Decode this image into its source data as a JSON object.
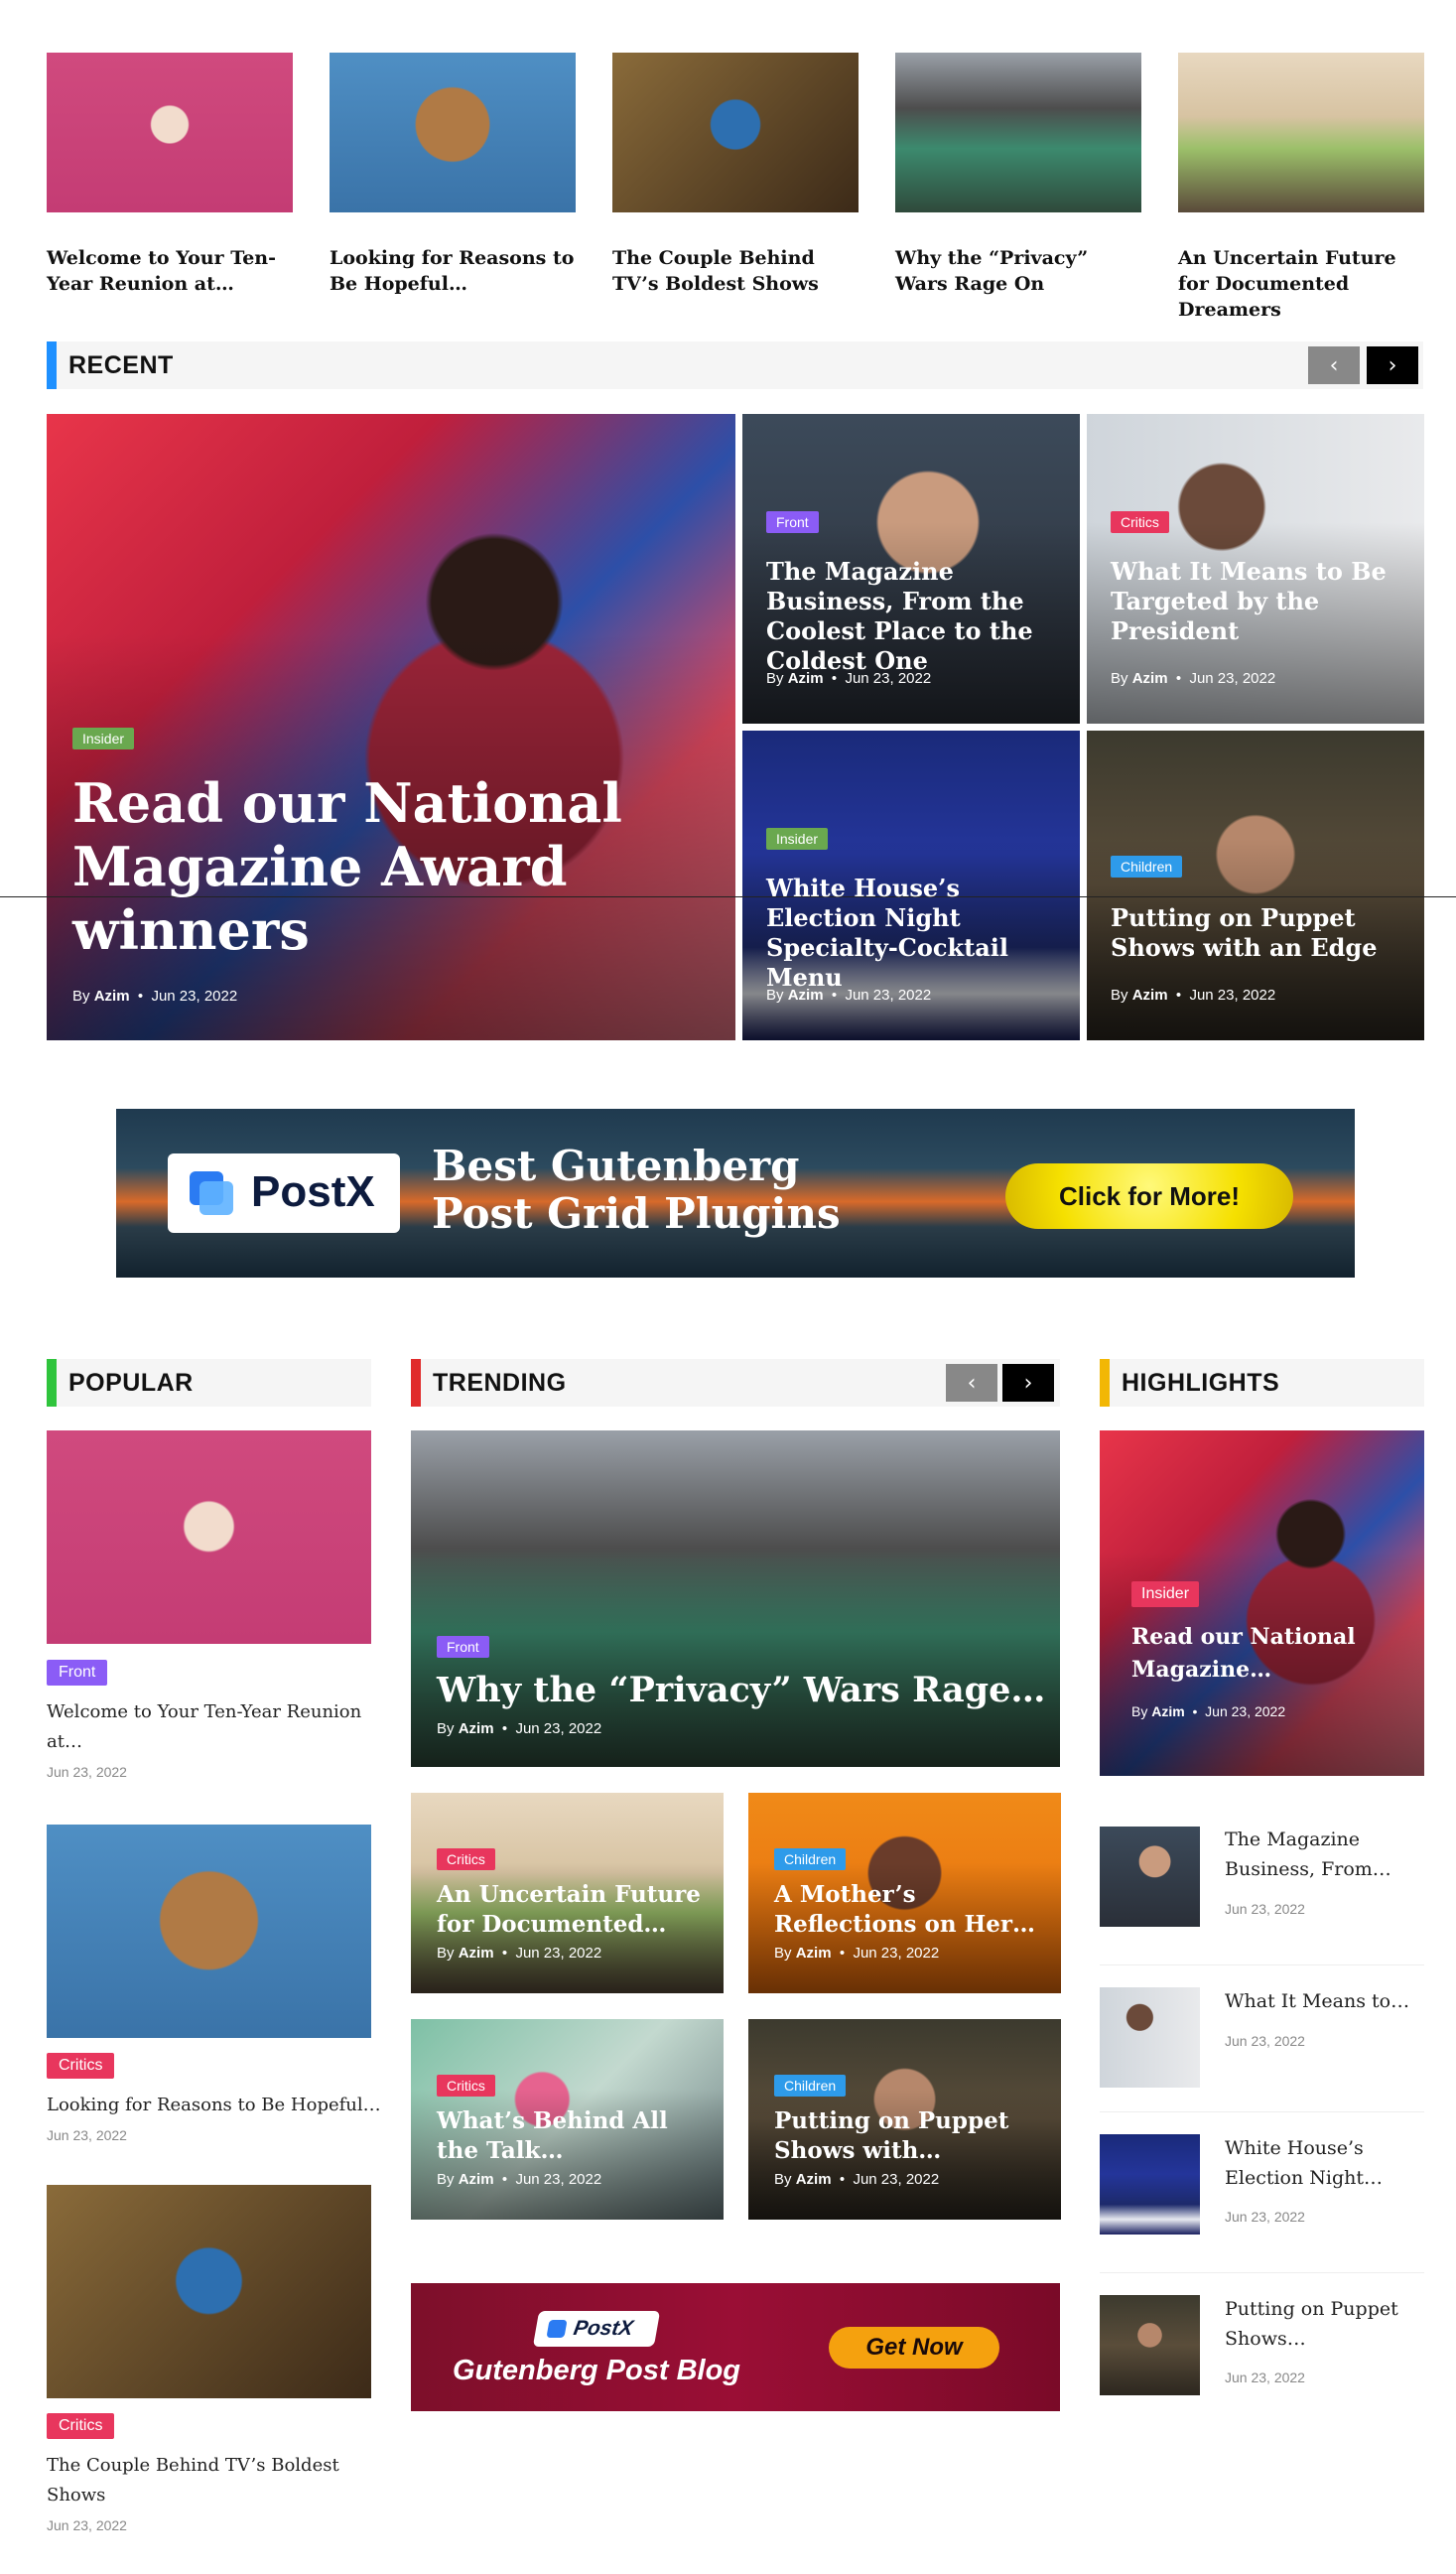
{
  "top_posts": [
    {
      "title": "Welcome to Your Ten-Year Reunion at…"
    },
    {
      "title": "Looking for Reasons to Be Hopeful…"
    },
    {
      "title": "The Couple Behind TV’s Boldest Shows"
    },
    {
      "title": "Why the “Privacy” Wars Rage On"
    },
    {
      "title": "An Uncertain Future for Documented Dreamers"
    }
  ],
  "recent": {
    "heading": "RECENT",
    "accent": "#1e90ff",
    "prev_icon": "‹",
    "next_icon": "›",
    "main": {
      "badge": "Insider",
      "title": "Read our National Magazine Award winners",
      "by": "By",
      "author": "Azim",
      "date": "Jun 23, 2022"
    },
    "grid": [
      {
        "badge": "Front",
        "title": "The Magazine Business, From the Coolest Place to the Coldest One",
        "by": "By",
        "author": "Azim",
        "date": "Jun 23, 2022"
      },
      {
        "badge": "Critics",
        "title": "What It Means to Be Targeted by the President",
        "by": "By",
        "author": "Azim",
        "date": "Jun 23, 2022"
      },
      {
        "badge": "Insider",
        "title": "White House’s Election Night Specialty-Cocktail Menu",
        "by": "By",
        "author": "Azim",
        "date": "Jun 23, 2022"
      },
      {
        "badge": "Children",
        "title": "Putting on Puppet Shows with an Edge",
        "by": "By",
        "author": "Azim",
        "date": "Jun 23, 2022"
      }
    ]
  },
  "banner1": {
    "logo": "PostX",
    "line1": "Best Gutenberg",
    "line2": "Post Grid Plugins",
    "cta": "Click for More!"
  },
  "popular": {
    "heading": "POPULAR",
    "accent": "#2fc43c",
    "items": [
      {
        "badge": "Front",
        "title": "Welcome to Your Ten-Year Reunion at…",
        "date": "Jun 23, 2022"
      },
      {
        "badge": "Critics",
        "title": "Looking for Reasons to Be Hopeful…",
        "date": "Jun 23, 2022"
      },
      {
        "badge": "Critics",
        "title": "The Couple Behind TV’s Boldest Shows",
        "date": "Jun 23, 2022"
      }
    ]
  },
  "trending": {
    "heading": "TRENDING",
    "accent": "#e02b2b",
    "prev_icon": "‹",
    "next_icon": "›",
    "main": {
      "badge": "Front",
      "title": "Why the “Privacy” Wars Rage…",
      "by": "By",
      "author": "Azim",
      "date": "Jun 23, 2022"
    },
    "grid": [
      {
        "badge": "Critics",
        "title": "An Uncertain Future for Documented…",
        "by": "By",
        "author": "Azim",
        "date": "Jun 23, 2022"
      },
      {
        "badge": "Children",
        "title": "A Mother’s Reflections on Her…",
        "by": "By",
        "author": "Azim",
        "date": "Jun 23, 2022"
      },
      {
        "badge": "Critics",
        "title": "What’s Behind All the Talk…",
        "by": "By",
        "author": "Azim",
        "date": "Jun 23, 2022"
      },
      {
        "badge": "Children",
        "title": "Putting on Puppet Shows with…",
        "by": "By",
        "author": "Azim",
        "date": "Jun 23, 2022"
      }
    ]
  },
  "banner2": {
    "logo": "PostX",
    "text": "Gutenberg Post Blog",
    "cta": "Get Now"
  },
  "highlights": {
    "heading": "HIGHLIGHTS",
    "accent": "#f2b705",
    "main": {
      "badge": "Insider",
      "title": "Read our National Magazine…",
      "by": "By",
      "author": "Azim",
      "date": "Jun 23, 2022"
    },
    "items": [
      {
        "title": "The Magazine Business, From…",
        "date": "Jun 23, 2022"
      },
      {
        "title": "What It Means to…",
        "date": "Jun 23, 2022"
      },
      {
        "title": "White House’s Election Night…",
        "date": "Jun 23, 2022"
      },
      {
        "title": "Putting on Puppet Shows…",
        "date": "Jun 23, 2022"
      }
    ]
  },
  "badge_colors": {
    "Front": "#8b5cf6",
    "Critics": "#e8365d",
    "Insider": "#6aa84f",
    "Children": "#2e9bea"
  }
}
